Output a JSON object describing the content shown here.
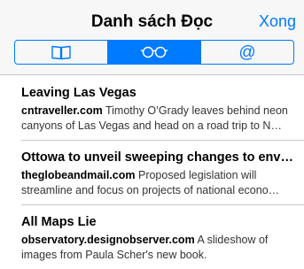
{
  "header": {
    "title": "Danh sách Đọc",
    "done_label": "Xong"
  },
  "segments": [
    {
      "icon": "book-icon",
      "label": "Bookmarks",
      "active": false
    },
    {
      "icon": "glasses-icon",
      "label": "Reading List",
      "active": true
    },
    {
      "icon": "at-icon",
      "label": "Shared Links",
      "glyph": "@",
      "active": false
    }
  ],
  "accent_color": "#007aff",
  "items": [
    {
      "title": "Leaving Las Vegas",
      "site": "cntraveller.com",
      "summary": "Timothy O’Grady leaves behind neon canyons of Las Vegas and head on a road trip to N…"
    },
    {
      "title": "Ottowa to unveil sweeping changes to envi…",
      "site": "theglobeandmail.com",
      "summary": "Proposed legislation will streamline and focus on projects of national econo…"
    },
    {
      "title": "All Maps Lie",
      "site": "observatory.designobserver.com",
      "summary": "A slideshow of images from Paula Scher's new book."
    }
  ]
}
